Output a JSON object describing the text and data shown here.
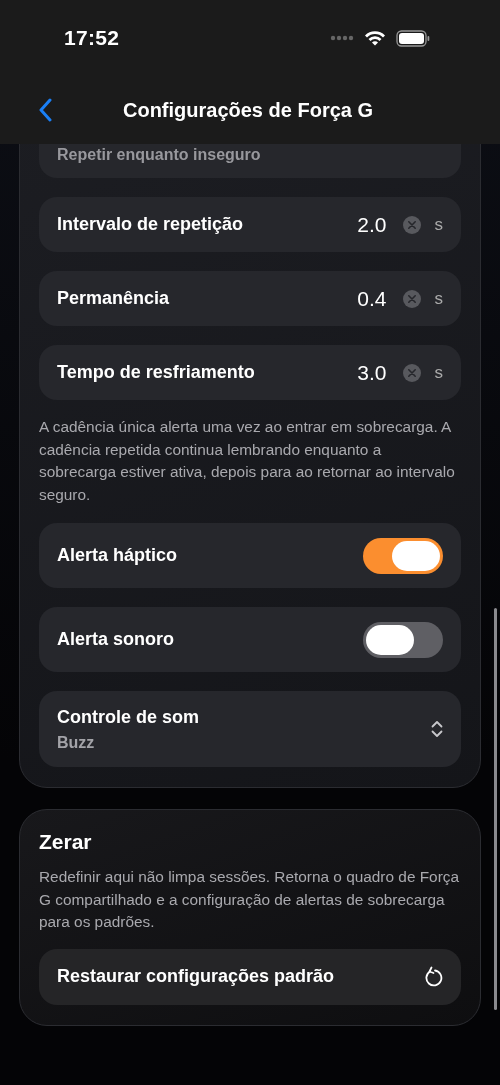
{
  "status_bar": {
    "time": "17:52"
  },
  "nav": {
    "title": "Configurações de Força G"
  },
  "alerts_card": {
    "rows": [
      {
        "kind": "partial_picker",
        "value": "Repetir enquanto inseguro"
      },
      {
        "kind": "number",
        "label": "Intervalo de repetição",
        "value": "2.0",
        "unit": "s"
      },
      {
        "kind": "number",
        "label": "Permanência",
        "value": "0.4",
        "unit": "s"
      },
      {
        "kind": "number",
        "label": "Tempo de resfriamento",
        "value": "3.0",
        "unit": "s"
      },
      {
        "kind": "note",
        "text": "A cadência única alerta uma vez ao entrar em sobrecarga. A cadência repetida continua lembrando enquanto a sobrecarga estiver ativa, depois para ao retornar ao intervalo seguro."
      },
      {
        "kind": "toggle",
        "label": "Alerta háptico",
        "on": true
      },
      {
        "kind": "toggle",
        "label": "Alerta sonoro",
        "on": false
      },
      {
        "kind": "picker",
        "label": "Controle de som",
        "value": "Buzz"
      }
    ]
  },
  "reset_card": {
    "title": "Zerar",
    "description": "Redefinir aqui não limpa sessões. Retorna o quadro de Força G compartilhado e a configuração de alertas de sobrecarga para os padrões.",
    "button": {
      "label": "Restaurar configurações padrão"
    }
  }
}
